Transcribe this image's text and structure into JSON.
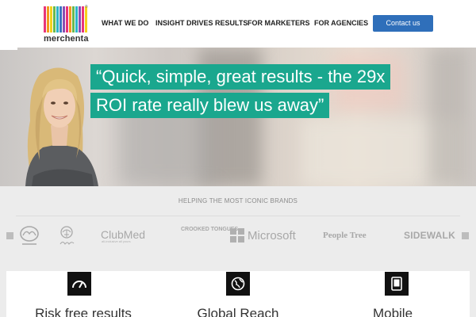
{
  "header": {
    "logo_text": "merchenta",
    "logo_colors": [
      "#e8357a",
      "#f29b1d",
      "#f4d21c",
      "#68b94e",
      "#2db4c8",
      "#3c74c0",
      "#8a4fb3",
      "#e8357a",
      "#f29b1d",
      "#68b94e",
      "#2db4c8",
      "#8a4fb3",
      "#e8357a",
      "#f4d21c"
    ],
    "nav": [
      "WHAT WE DO",
      "INSIGHT DRIVES RESULTS",
      "FOR MARKETERS",
      "FOR AGENCIES"
    ],
    "contact_label": "Contact us",
    "accent_color": "#2f6fba"
  },
  "hero": {
    "quote_line_1": "“Quick, simple, great results - the 29x",
    "quote_line_2": "ROI rate really blew us away”",
    "quote_bg_color": "#1aa78e"
  },
  "brands": {
    "heading": "HELPING THE MOST ICONIC BRANDS",
    "logos": [
      {
        "name": "mazda",
        "text": ""
      },
      {
        "name": "brand-tree",
        "text": ""
      },
      {
        "name": "club-med",
        "text": "ClubMed",
        "sub": "all-inclusive all yours"
      },
      {
        "name": "crooked-tongues",
        "text": "CROOKED TONGUES"
      },
      {
        "name": "microsoft",
        "text": "Microsoft"
      },
      {
        "name": "people-tree",
        "text": "People Tree"
      },
      {
        "name": "sidewalk",
        "text": "SIDEWALK"
      }
    ]
  },
  "features": [
    {
      "title": "Risk free results",
      "icon": "speedometer-icon"
    },
    {
      "title": "Global Reach",
      "icon": "globe-icon"
    },
    {
      "title": "Mobile",
      "icon": "tablet-icon"
    }
  ]
}
